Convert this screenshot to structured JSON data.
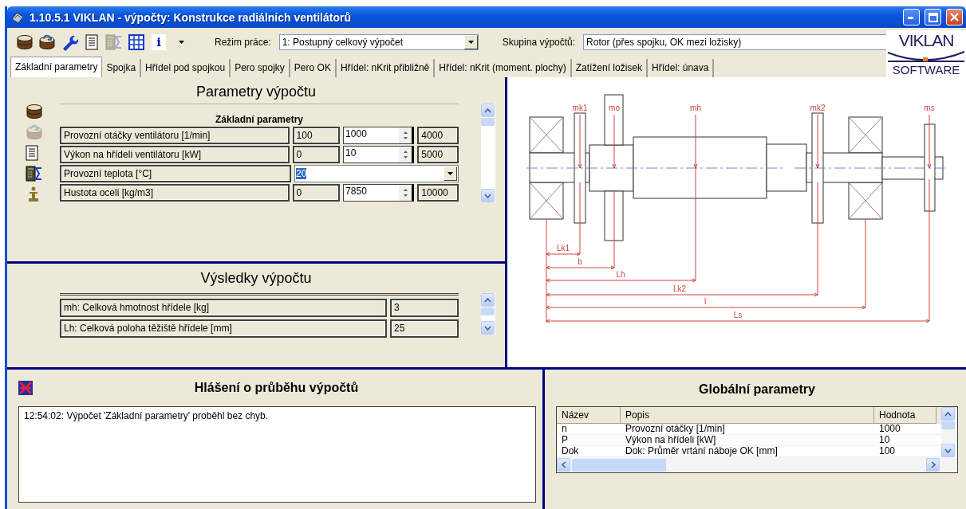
{
  "window": {
    "title": "1.10.5.1 VIKLAN - výpočty: Konstrukce radiálních ventilátorů"
  },
  "toolbar": {
    "buttons": [
      {
        "kind": "database",
        "disabled": false
      },
      {
        "kind": "database-refresh",
        "disabled": false
      },
      {
        "kind": "wrench",
        "disabled": false
      },
      {
        "kind": "document",
        "disabled": false
      },
      {
        "kind": "calculator",
        "disabled": true
      },
      {
        "kind": "grid",
        "disabled": false
      },
      {
        "kind": "info",
        "glyph": "i",
        "disabled": false
      },
      {
        "kind": "dropdown",
        "disabled": false
      }
    ],
    "mode": {
      "label": "Režim práce:",
      "value": "1: Postupný celkový výpočet"
    },
    "group": {
      "label": "Skupina výpočtů:",
      "value": "Rotor (přes spojku, OK mezi ložisky)"
    }
  },
  "logo": {
    "line_1": "VIKLAN",
    "line_2": "SOFTWARE"
  },
  "tabs": [
    {
      "label": "Základní parametry",
      "selected": true
    },
    {
      "label": "Spojka",
      "selected": false
    },
    {
      "label": "Hřídel pod spojkou",
      "selected": false
    },
    {
      "label": "Pero spojky",
      "selected": false
    },
    {
      "label": "Pero OK",
      "selected": false
    },
    {
      "label": "Hřídel: nKrit přibližně",
      "selected": false
    },
    {
      "label": "Hřídel: nKrit (moment. plochy)",
      "selected": false
    },
    {
      "label": "Zatížení ložisek",
      "selected": false
    },
    {
      "label": "Hřídel: únava",
      "selected": false
    }
  ],
  "parameters": {
    "title": "Parametry výpočtu",
    "side_icons": [
      {
        "kind": "database",
        "disabled": false
      },
      {
        "kind": "database-refresh",
        "disabled": true
      },
      {
        "kind": "document",
        "disabled": false
      },
      {
        "kind": "calculator",
        "disabled": false
      },
      {
        "kind": "pedestal",
        "disabled": false
      }
    ],
    "section": "Základní parametry",
    "rows": [
      {
        "kind": "range",
        "label": "Provozní otáčky ventilátoru [1/min]",
        "min": "100",
        "value": "1000",
        "max": "4000"
      },
      {
        "kind": "range",
        "label": "Výkon na hřídeli ventilátoru [kW]",
        "min": "0",
        "value": "10",
        "max": "5000"
      },
      {
        "kind": "select",
        "label": "Provozní teplota [°C]",
        "value": "20"
      },
      {
        "kind": "range",
        "label": "Hustota oceli [kg/m3]",
        "min": "0",
        "value": "7850",
        "max": "10000"
      }
    ]
  },
  "results": {
    "title": "Výsledky výpočtu",
    "rows": [
      {
        "label": "mh: Celková hmotnost hřídele [kg]",
        "value": "3"
      },
      {
        "label": "Lh: Celková poloha těžiště hřídele [mm]",
        "value": "25"
      }
    ]
  },
  "diagram": {
    "labels": [
      "mk1",
      "mo",
      "mh",
      "mk2",
      "ms",
      "Lk1",
      "b",
      "Lh",
      "Lk2",
      "l",
      "Ls"
    ]
  },
  "messages": {
    "title": "Hlášení o průběhu výpočtů",
    "items": [
      "12:54:02: Výpočet 'Základní parametry' proběhl bez chyb."
    ]
  },
  "globals": {
    "title": "Globální parametry",
    "columns": [
      "Název",
      "Popis",
      "Hodnota"
    ],
    "rows": [
      [
        "n",
        "Provozní otáčky [1/min]",
        "1000"
      ],
      [
        "P",
        "Výkon na hřídeli [kW]",
        "10"
      ],
      [
        "Dok",
        "Dok: Průměr vrtání náboje OK [mm]",
        "100"
      ]
    ]
  }
}
